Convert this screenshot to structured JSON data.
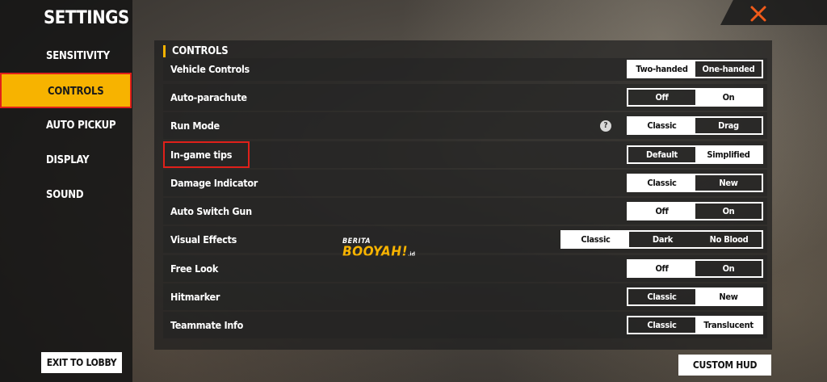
{
  "sidebar": {
    "title": "SETTINGS",
    "items": [
      {
        "label": "SENSITIVITY",
        "active": false
      },
      {
        "label": "CONTROLS",
        "active": true
      },
      {
        "label": "AUTO PICKUP",
        "active": false
      },
      {
        "label": "DISPLAY",
        "active": false
      },
      {
        "label": "SOUND",
        "active": false
      }
    ],
    "exit_label": "EXIT TO LOBBY"
  },
  "header": {
    "section_title": "CONTROLS"
  },
  "colors": {
    "accent": "#f7b300",
    "highlight": "#e0201a"
  },
  "close": {
    "icon": "close-icon"
  },
  "rows": [
    {
      "label": "Vehicle Controls",
      "options": [
        "Two-handed",
        "One-handed"
      ],
      "selected": 0
    },
    {
      "label": "Auto-parachute",
      "options": [
        "Off",
        "On"
      ],
      "selected": 1
    },
    {
      "label": "Run Mode",
      "options": [
        "Classic",
        "Drag"
      ],
      "selected": 0,
      "help": "?"
    },
    {
      "label": "In-game tips",
      "options": [
        "Default",
        "Simplified"
      ],
      "selected": 1
    },
    {
      "label": "Damage Indicator",
      "options": [
        "Classic",
        "New"
      ],
      "selected": 0
    },
    {
      "label": "Auto Switch Gun",
      "options": [
        "Off",
        "On"
      ],
      "selected": 0
    },
    {
      "label": "Visual Effects",
      "options": [
        "Classic",
        "Dark",
        "No Blood"
      ],
      "selected": 0
    },
    {
      "label": "Free Look",
      "options": [
        "Off",
        "On"
      ],
      "selected": 0
    },
    {
      "label": "Hitmarker",
      "options": [
        "Classic",
        "New"
      ],
      "selected": 1
    },
    {
      "label": "Teammate Info",
      "options": [
        "Classic",
        "Translucent"
      ],
      "selected": 1
    }
  ],
  "watermark": {
    "top": "BERITA",
    "main": "BOOYAH!",
    "suffix": ".id"
  },
  "custom_hud_label": "CUSTOM HUD"
}
